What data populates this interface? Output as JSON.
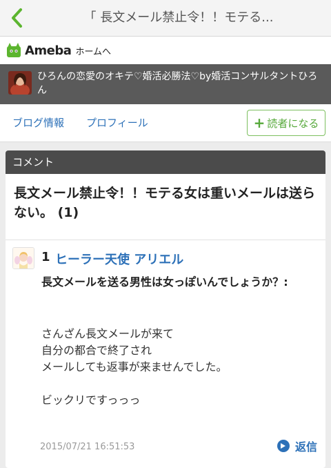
{
  "header": {
    "page_title": "「 長文メール禁止令！！モテる...",
    "accent_color": "#5cb52f"
  },
  "ameba": {
    "logo_text": "Ameba",
    "home_link": "ホームへ"
  },
  "blog": {
    "title": "ひろんの恋愛のオキテ♡婚活必勝法♡by婚活コンサルタントひろん"
  },
  "nav": {
    "blog_info": "ブログ情報",
    "profile": "プロフィール",
    "become_reader": "読者になる"
  },
  "comments_section": {
    "heading": "コメント",
    "entry_title": "長文メール禁止令！！モテる女は重いメールは送らない。 (1)"
  },
  "comment": {
    "number": "1",
    "author": "ヒーラー天使 アリエル",
    "subject": "長文メールを送る男性は女っぽいんでしょうか？:",
    "body_lines": [
      "さんざん長文メールが来て",
      "自分の都合で終了され",
      "メールしても返事が来ませんでした。",
      "",
      "ビックリですっっっ"
    ],
    "date": "2015/07/21 16:51:53",
    "reply_label": "返信"
  }
}
